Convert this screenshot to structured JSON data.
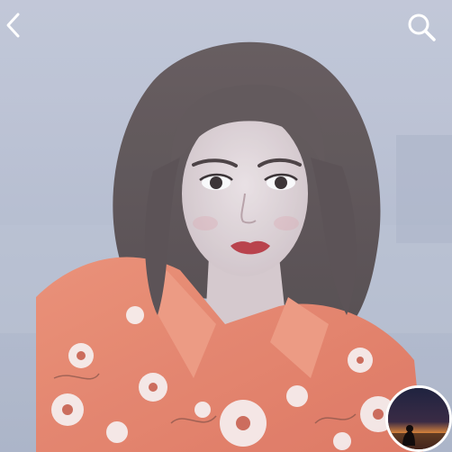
{
  "top_bar": {
    "back_icon": "chevron-left-icon",
    "search_icon": "search-icon"
  },
  "photo": {
    "subject": "portrait"
  },
  "music_disc": {
    "caption_line1": "",
    "caption_line2": ""
  },
  "colors": {
    "background": "#b9bfd3",
    "shirt": "#e87a5c",
    "icon": "#ffffff"
  }
}
